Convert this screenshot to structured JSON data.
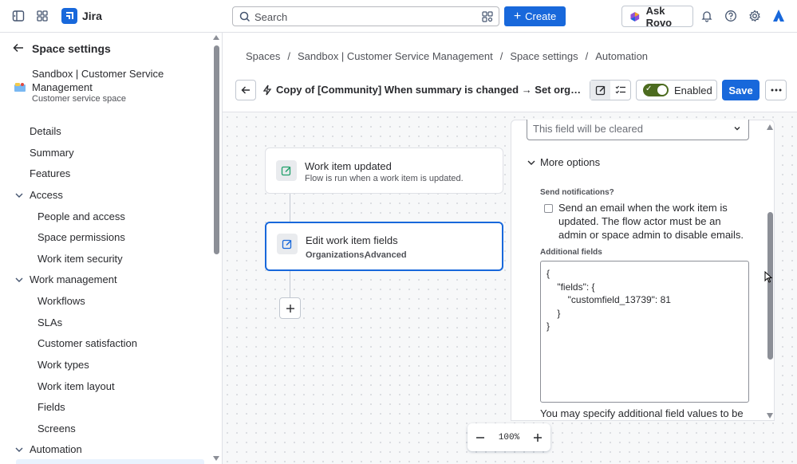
{
  "topbar": {
    "app_name": "Jira",
    "search_placeholder": "Search",
    "create_label": "Create",
    "ask_rovo_label": "Ask Rovo"
  },
  "sidebar": {
    "title": "Space settings",
    "space_name": "Sandbox | Customer Service Management",
    "space_type": "Customer service space",
    "items": [
      {
        "label": "Details",
        "level": 0
      },
      {
        "label": "Summary",
        "level": 0
      },
      {
        "label": "Features",
        "level": 0
      },
      {
        "label": "Access",
        "level": 0,
        "expanded": true
      },
      {
        "label": "People and access",
        "level": 1
      },
      {
        "label": "Space permissions",
        "level": 1
      },
      {
        "label": "Work item security",
        "level": 1
      },
      {
        "label": "Work management",
        "level": 0,
        "expanded": true
      },
      {
        "label": "Workflows",
        "level": 1
      },
      {
        "label": "SLAs",
        "level": 1
      },
      {
        "label": "Customer satisfaction",
        "level": 1
      },
      {
        "label": "Work types",
        "level": 1
      },
      {
        "label": "Work item layout",
        "level": 1
      },
      {
        "label": "Fields",
        "level": 1
      },
      {
        "label": "Screens",
        "level": 1
      },
      {
        "label": "Automation",
        "level": 0,
        "expanded": true
      }
    ]
  },
  "breadcrumb": [
    "Spaces",
    "Sandbox | Customer Service Management",
    "Space settings",
    "Automation"
  ],
  "rule": {
    "title": "Copy of [Community] When summary is changed → Set organiza...",
    "enabled_label": "Enabled",
    "save_label": "Save"
  },
  "flow": {
    "trigger": {
      "title": "Work item updated",
      "subtitle": "Flow is run when a work item is updated."
    },
    "action": {
      "title": "Edit work item fields",
      "fields_1": "Organizations,",
      "fields_2": "Advanced"
    }
  },
  "panel": {
    "dropdown_value": "This field will be cleared",
    "more_options_label": "More options",
    "send_notifications_label": "Send notifications?",
    "send_email_text": "Send an email when the work item is updated. The flow actor must be an admin or space admin to disable emails.",
    "additional_fields_label": "Additional fields",
    "additional_fields_value": "{\n    \"fields\": {\n        \"customfield_13739\": 81\n    }\n}",
    "help_text": "You may specify additional field values to be"
  },
  "zoom": {
    "level": "100%"
  },
  "colors": {
    "brand": "#1868db",
    "toggle_on": "#4c6b1f",
    "selected_border": "#1868db"
  }
}
